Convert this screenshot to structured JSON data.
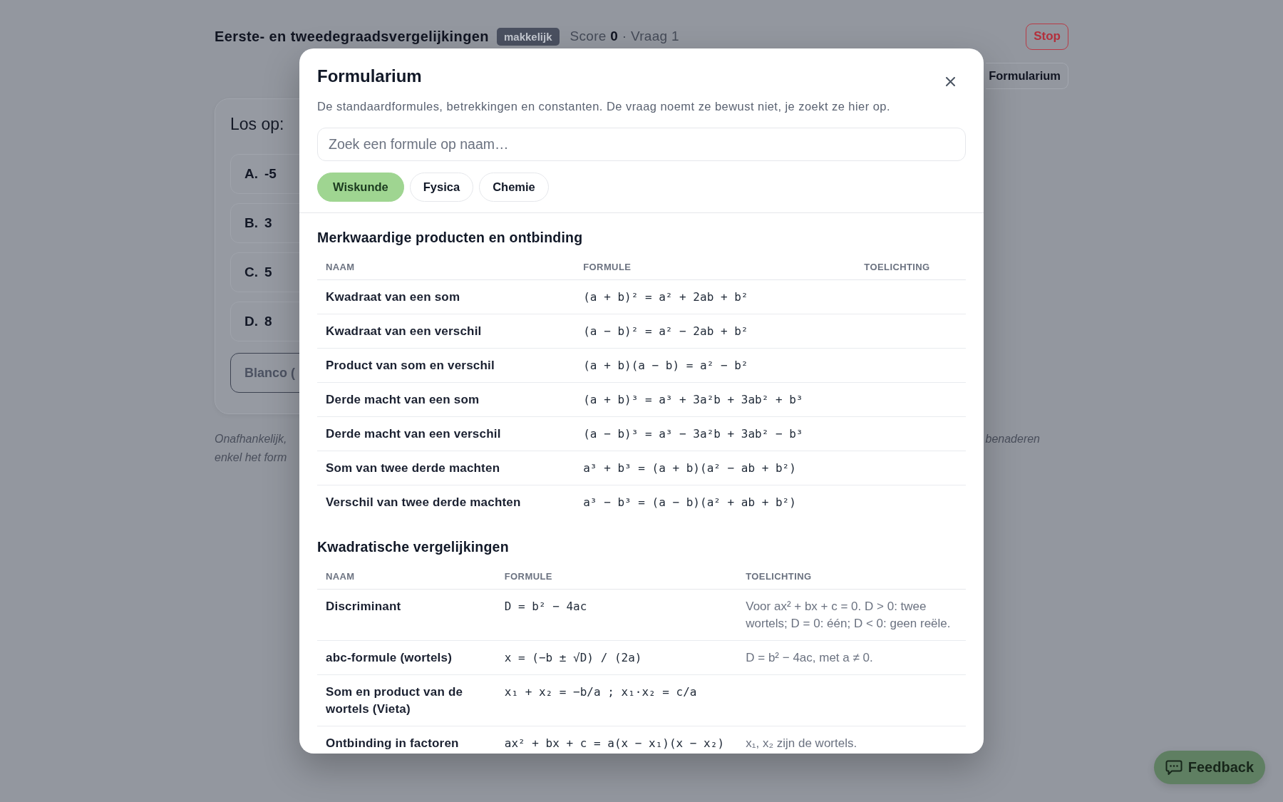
{
  "quiz_header": {
    "title": "Eerste- en tweedegraadsvergelijkingen",
    "difficulty": "makkelijk",
    "score_text": "Score **0** · Vraag 1",
    "stop_button": "Stop",
    "formularium_button": "Formularium"
  },
  "question_card": {
    "prompt": "Los op:",
    "options": [
      {
        "letter": "A.",
        "value": "-5"
      },
      {
        "letter": "B.",
        "value": "3"
      },
      {
        "letter": "C.",
        "value": "5"
      },
      {
        "letter": "D.",
        "value": "8"
      }
    ],
    "blank_option": "Blanco ("
  },
  "footnote": {
    "left_lines": [
      "Onafhankelijk,",
      "enkel het form"
    ],
    "right_fragment": "benaderen"
  },
  "formularium_dialog": {
    "title": "Formularium",
    "description": "De standaardformules, betrekkingen en constanten. De vraag noemt ze bewust niet, je zoekt ze hier op.",
    "search": {
      "placeholder": "Zoek een formule op naam…"
    },
    "tabs": [
      {
        "label": "Wiskunde",
        "selected": true
      },
      {
        "label": "Fysica",
        "selected": false
      },
      {
        "label": "Chemie",
        "selected": false
      }
    ],
    "sections": [
      {
        "title": "Merkwaardige producten en ontbinding",
        "columns": [
          "NAAM",
          "FORMULE",
          "TOELICHTING"
        ],
        "rows": [
          {
            "name": "Kwadraat van een som",
            "formula": "(a + b)² = a² + 2ab + b²"
          },
          {
            "name": "Kwadraat van een verschil",
            "formula": "(a − b)² = a² − 2ab + b²"
          },
          {
            "name": "Product van som en verschil",
            "formula": "(a + b)(a − b) = a² − b²"
          },
          {
            "name": "Derde macht van een som",
            "formula": "(a + b)³ = a³ + 3a²b + 3ab² + b³"
          },
          {
            "name": "Derde macht van een verschil",
            "formula": "(a − b)³ = a³ − 3a²b + 3ab² − b³"
          },
          {
            "name": "Som van twee derde machten",
            "formula": "a³ + b³ = (a + b)(a² − ab + b²)"
          },
          {
            "name": "Verschil van twee derde machten",
            "formula": "a³ − b³ = (a − b)(a² + ab + b²)"
          }
        ]
      },
      {
        "title": "Kwadratische vergelijkingen",
        "columns": [
          "NAAM",
          "FORMULE",
          "TOELICHTING"
        ],
        "rows": [
          {
            "name": "Discriminant",
            "formula": "D = b² − 4ac",
            "explanation": "Voor ax² + bx + c = 0. D > 0: twee wortels; D = 0: één; D < 0: geen reële."
          },
          {
            "name": "abc-formule (wortels)",
            "formula": "x = (−b ± √D) / (2a)",
            "explanation": "D = b² − 4ac, met a ≠ 0."
          },
          {
            "name": "Som en product van de wortels (Vieta)",
            "formula": "x₁ + x₂ = −b/a ; x₁·x₂ = c/a"
          },
          {
            "name": "Ontbinding in factoren",
            "formula": "ax² + bx + c = a(x − x₁)(x − x₂)",
            "explanation": "x₁, x₂ zijn de wortels."
          }
        ]
      }
    ]
  },
  "feedback_button": "Feedback"
}
